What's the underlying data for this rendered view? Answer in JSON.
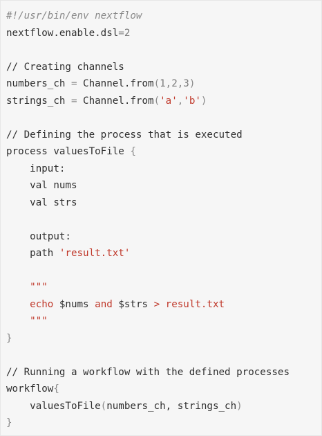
{
  "colors": {
    "background": "#f6f6f6",
    "border": "#e6e6e6",
    "text": "#2f2f2f",
    "muted": "#8a8a8a",
    "string": "#c0392b"
  },
  "code": {
    "lines": [
      [
        {
          "t": "#!/usr/bin/env nextflow",
          "c": "comment-italic"
        }
      ],
      [
        {
          "t": "nextflow.enable.dsl",
          "c": "plain"
        },
        {
          "t": "=",
          "c": "op"
        },
        {
          "t": "2",
          "c": "number"
        }
      ],
      [],
      [
        {
          "t": "// Creating channels",
          "c": "comment"
        }
      ],
      [
        {
          "t": "numbers_ch ",
          "c": "plain"
        },
        {
          "t": "=",
          "c": "op"
        },
        {
          "t": " Channel.from",
          "c": "plain"
        },
        {
          "t": "(",
          "c": "op"
        },
        {
          "t": "1",
          "c": "number"
        },
        {
          "t": ",",
          "c": "op"
        },
        {
          "t": "2",
          "c": "number"
        },
        {
          "t": ",",
          "c": "op"
        },
        {
          "t": "3",
          "c": "number"
        },
        {
          "t": ")",
          "c": "op"
        }
      ],
      [
        {
          "t": "strings_ch ",
          "c": "plain"
        },
        {
          "t": "=",
          "c": "op"
        },
        {
          "t": " Channel.from",
          "c": "plain"
        },
        {
          "t": "(",
          "c": "op"
        },
        {
          "t": "'a'",
          "c": "string"
        },
        {
          "t": ",",
          "c": "op"
        },
        {
          "t": "'b'",
          "c": "string"
        },
        {
          "t": ")",
          "c": "op"
        }
      ],
      [],
      [
        {
          "t": "// Defining the process that is executed",
          "c": "comment"
        }
      ],
      [
        {
          "t": "process valuesToFile ",
          "c": "plain"
        },
        {
          "t": "{",
          "c": "op"
        }
      ],
      [
        {
          "t": "    input:",
          "c": "plain"
        }
      ],
      [
        {
          "t": "    val nums",
          "c": "plain"
        }
      ],
      [
        {
          "t": "    val strs",
          "c": "plain"
        }
      ],
      [],
      [
        {
          "t": "    output:",
          "c": "plain"
        }
      ],
      [
        {
          "t": "    path ",
          "c": "plain"
        },
        {
          "t": "'result.txt'",
          "c": "string"
        }
      ],
      [],
      [
        {
          "t": "    ",
          "c": "plain"
        },
        {
          "t": "\"\"\"",
          "c": "string"
        }
      ],
      [
        {
          "t": "    ",
          "c": "plain"
        },
        {
          "t": "echo ",
          "c": "keyword"
        },
        {
          "t": "$nums",
          "c": "var"
        },
        {
          "t": " and ",
          "c": "keyword"
        },
        {
          "t": "$strs",
          "c": "var"
        },
        {
          "t": " > result.txt",
          "c": "keyword"
        }
      ],
      [
        {
          "t": "    ",
          "c": "plain"
        },
        {
          "t": "\"\"\"",
          "c": "string"
        }
      ],
      [
        {
          "t": "}",
          "c": "op"
        }
      ],
      [],
      [
        {
          "t": "// Running a workflow with the defined processes",
          "c": "comment"
        }
      ],
      [
        {
          "t": "workflow",
          "c": "plain"
        },
        {
          "t": "{",
          "c": "op"
        }
      ],
      [
        {
          "t": "    valuesToFile",
          "c": "plain"
        },
        {
          "t": "(",
          "c": "op"
        },
        {
          "t": "numbers_ch, strings_ch",
          "c": "plain"
        },
        {
          "t": ")",
          "c": "op"
        }
      ],
      [
        {
          "t": "}",
          "c": "op"
        }
      ]
    ]
  }
}
